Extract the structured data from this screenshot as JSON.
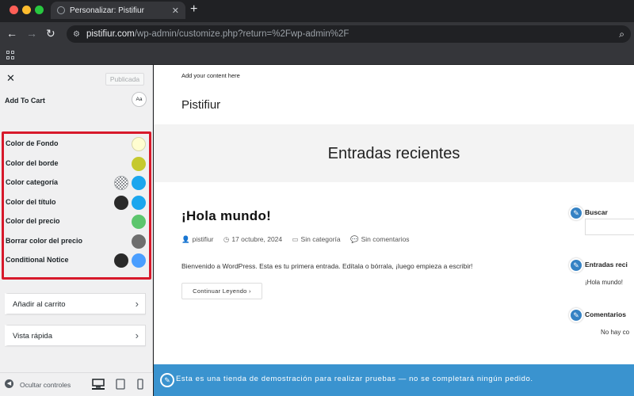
{
  "browser": {
    "tab_title": "Personalizar: Pistifiur",
    "new_tab": "+",
    "url_host": "pistifiur.com",
    "url_path": "/wp-admin/customize.php?return=%2Fwp-admin%2F"
  },
  "panel": {
    "publish_label": "Publicada",
    "section_title": "Add To Cart",
    "font_button": "Aa",
    "colors": [
      {
        "label": "Color de Fondo",
        "swatch": "#fffdd0"
      },
      {
        "label": "Color del borde",
        "swatch": "#c5c92e"
      },
      {
        "label": "Color categoría",
        "swatch": "#1ba6ee",
        "alt": "transparent"
      },
      {
        "label": "Color del título",
        "swatch": "#1ba6ee",
        "alt": "#2a2a2a"
      },
      {
        "label": "Color del precio",
        "swatch": "#5cc56d"
      },
      {
        "label": "Borrar color del precio",
        "swatch": "#6e6e6e"
      },
      {
        "label": "Conditional Notice",
        "swatch": "#4a9eff",
        "alt": "#2a2a2a"
      }
    ],
    "accordion": [
      {
        "label": "Añadir al carrito"
      },
      {
        "label": "Vista rápida"
      }
    ],
    "hide_controls": "Ocultar controles",
    "highlight_color": "#d7192b"
  },
  "preview": {
    "top_note": "Add your content here",
    "site_title": "Pistifiur",
    "hero_title": "Entradas recientes",
    "post_title": "¡Hola mundo!",
    "meta": {
      "author": "pistifiur",
      "date": "17 octubre, 2024",
      "category": "Sin categoría",
      "comments": "Sin comentarios"
    },
    "excerpt": "Bienvenido a WordPress. Esta es tu primera entrada. Edítala o bórrala, ¡luego empieza a escribir!",
    "more_button": "Continuar Leyendo",
    "sidebar": {
      "search_title": "Buscar",
      "recent_title": "Entradas reci",
      "recent_item": "¡Hola mundo!",
      "comments_title": "Comentarios",
      "comments_text": "No hay co"
    },
    "demo_notice": "Esta es una tienda de demostración para realizar pruebas — no se completará ningún pedido.",
    "demo_bar_color": "#3a93cf"
  }
}
